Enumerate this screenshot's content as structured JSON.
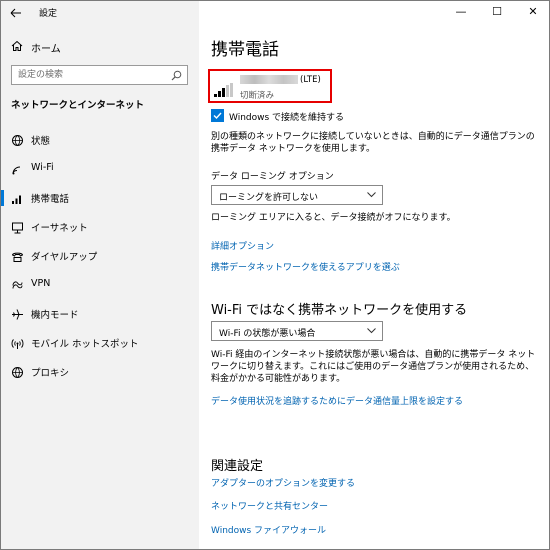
{
  "window": {
    "title": "設定",
    "minimize": "—",
    "maximize": "☐",
    "close": "✕"
  },
  "sidebar": {
    "home_label": "ホーム",
    "search_placeholder": "設定の検索",
    "section_title": "ネットワークとインターネット",
    "items": [
      {
        "label": "状態",
        "icon": "globe-status-icon"
      },
      {
        "label": "Wi-Fi",
        "icon": "wifi-icon"
      },
      {
        "label": "携帯電話",
        "icon": "cellular-icon",
        "selected": true
      },
      {
        "label": "イーサネット",
        "icon": "ethernet-icon"
      },
      {
        "label": "ダイヤルアップ",
        "icon": "dialup-icon"
      },
      {
        "label": "VPN",
        "icon": "vpn-icon"
      },
      {
        "label": "機内モード",
        "icon": "airplane-icon"
      },
      {
        "label": "モバイル ホットスポット",
        "icon": "hotspot-icon"
      },
      {
        "label": "プロキシ",
        "icon": "proxy-icon"
      }
    ]
  },
  "main": {
    "title": "携帯電話",
    "connection": {
      "carrier_suffix": "(LTE)",
      "status": "切断済み"
    },
    "keep_connected_label": "Windows で接続を維持する",
    "keep_connected_desc": "別の種類のネットワークに接続していないときは、自動的にデータ通信プランの携帯データ ネットワークを使用します。",
    "roaming": {
      "label": "データ ローミング オプション",
      "value": "ローミングを許可しない",
      "desc": "ローミング エリアに入ると、データ接続がオフになります。"
    },
    "advanced_link": "詳細オプション",
    "apps_link": "携帯データネットワークを使えるアプリを選ぶ",
    "wifi_section": {
      "title": "Wi-Fi ではなく携帯ネットワークを使用する",
      "value": "Wi-Fi の状態が悪い場合",
      "desc": "Wi-Fi 経由のインターネット接続状態が悪い場合は、自動的に携帯データ ネットワークに切り替えます。これにはご使用のデータ通信プランが使用されるため、料金がかかる可能性があります。",
      "link": "データ使用状況を追跡するためにデータ通信量上限を設定する"
    },
    "related": {
      "title": "関連設定",
      "links": [
        "アダプターのオプションを変更する",
        "ネットワークと共有センター",
        "Windows ファイアウォール"
      ]
    }
  },
  "colors": {
    "accent": "#0078d7",
    "link": "#0063b1",
    "highlight_border": "#e60000"
  }
}
